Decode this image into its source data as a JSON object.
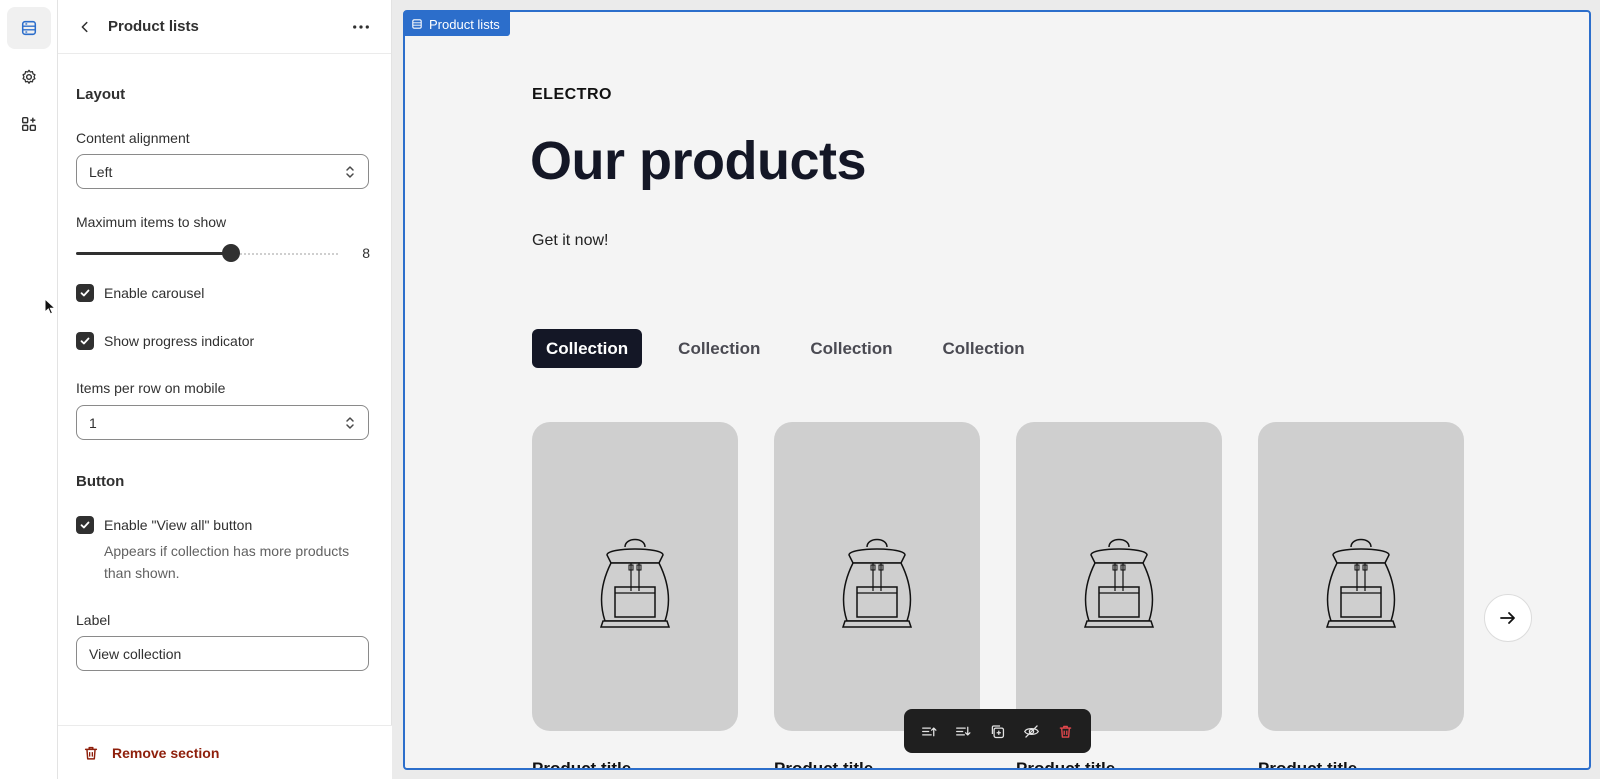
{
  "rail": {
    "items": [
      {
        "icon": "sections-icon"
      },
      {
        "icon": "gear-icon"
      },
      {
        "icon": "apps-icon"
      }
    ]
  },
  "panel": {
    "title": "Product lists",
    "layout": {
      "heading": "Layout",
      "content_alignment_label": "Content alignment",
      "content_alignment_value": "Left",
      "max_items_label": "Maximum items to show",
      "max_items_value": "8",
      "max_items_fraction": 0.59,
      "enable_carousel_label": "Enable carousel",
      "enable_carousel_checked": true,
      "show_progress_label": "Show progress indicator",
      "show_progress_checked": true,
      "items_per_row_label": "Items per row on mobile",
      "items_per_row_value": "1"
    },
    "button": {
      "heading": "Button",
      "enable_view_all_label": "Enable \"View all\" button",
      "enable_view_all_checked": true,
      "help_text": "Appears if collection has more products than shown.",
      "label_field_label": "Label",
      "label_field_value": "View collection"
    },
    "footer": {
      "remove_label": "Remove section"
    }
  },
  "preview": {
    "section_tag": "Product lists",
    "brand": "ELECTRO",
    "headline": "Our products",
    "subtitle": "Get it now!",
    "tabs": [
      {
        "label": "Collection",
        "active": true
      },
      {
        "label": "Collection",
        "active": false
      },
      {
        "label": "Collection",
        "active": false
      },
      {
        "label": "Collection",
        "active": false
      }
    ],
    "products": [
      {
        "title": "Product title"
      },
      {
        "title": "Product title"
      },
      {
        "title": "Product title"
      },
      {
        "title": "Product title"
      }
    ],
    "toolbar": [
      "move-up-icon",
      "move-down-icon",
      "duplicate-icon",
      "hide-icon",
      "delete-icon"
    ]
  },
  "colors": {
    "accent": "#2c6ecb",
    "dark": "#141726",
    "danger": "#8e1f0b",
    "placeholder": "#cfcfcf"
  }
}
